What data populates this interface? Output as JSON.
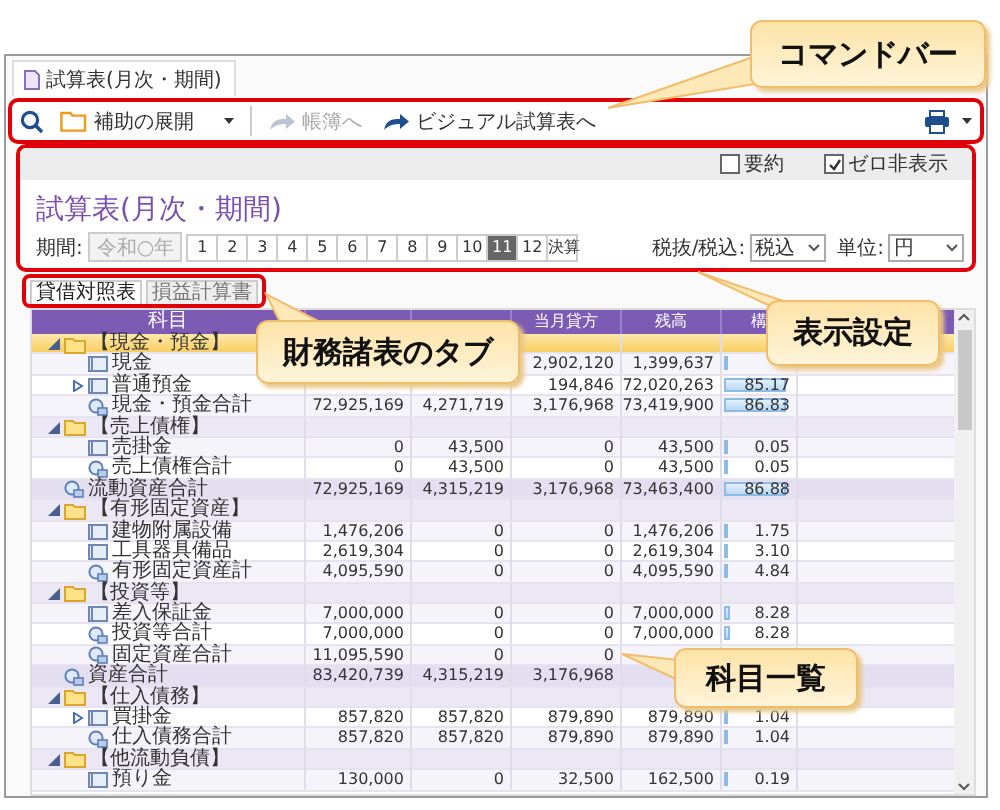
{
  "document_tab": {
    "title": "試算表(月次・期間)"
  },
  "command_bar": {
    "buttons": [
      {
        "kind": "expand",
        "label": "補助の展開",
        "disabled": false
      },
      {
        "kind": "jump",
        "label": "帳簿へ",
        "disabled": true
      },
      {
        "kind": "jump",
        "label": "ビジュアル試算表へ",
        "disabled": false
      }
    ]
  },
  "options": [
    {
      "label": "要約",
      "checked": false
    },
    {
      "label": "ゼロ非表示",
      "checked": true
    }
  ],
  "title": "試算表(月次・期間)",
  "period": {
    "label": "期間:",
    "year": "令和○年",
    "year_disabled": true,
    "months": [
      {
        "label": "1",
        "selected": false
      },
      {
        "label": "2",
        "selected": false
      },
      {
        "label": "3",
        "selected": false
      },
      {
        "label": "4",
        "selected": false
      },
      {
        "label": "5",
        "selected": false
      },
      {
        "label": "6",
        "selected": false
      },
      {
        "label": "7",
        "selected": false
      },
      {
        "label": "8",
        "selected": false
      },
      {
        "label": "9",
        "selected": false
      },
      {
        "label": "10",
        "selected": false
      },
      {
        "label": "11",
        "selected": true
      },
      {
        "label": "12",
        "selected": false
      },
      {
        "label": "決算",
        "selected": false
      }
    ]
  },
  "tax": {
    "label": "税抜/税込:",
    "value": "税込"
  },
  "unit": {
    "label": "単位:",
    "value": "円"
  },
  "statement_tabs": [
    {
      "label": "貸借対照表",
      "selected": true
    },
    {
      "label": "損益計算書",
      "selected": false
    }
  ],
  "table": {
    "columns": {
      "column_1": "科目",
      "column_4": "当月貸方",
      "column_5": "残高",
      "column_6": "構"
    },
    "rows": [
      {
        "kind": "group",
        "name": "【現金・預金】",
        "expanded": true,
        "selected": true,
        "children": [
          {
            "kind": "account",
            "name": "現金",
            "values": {
              "column_4": "2,902,120",
              "column_5": "1,399,637"
            },
            "level": 0.0165
          },
          {
            "kind": "account",
            "name": "普通預金",
            "expanded": false,
            "values": {
              "column_4": "194,846",
              "column_5": "72,020,263",
              "column_6": "85.17"
            },
            "level": 0.8517
          },
          {
            "kind": "total",
            "name": "現金・預金合計",
            "values": {
              "column_2": "72,925,169",
              "column_3": "4,271,719",
              "column_4": "3,176,968",
              "column_5": "73,419,900",
              "column_6": "86.83"
            },
            "level": 0.8683
          }
        ]
      },
      {
        "kind": "group",
        "name": "【売上債権】",
        "expanded": true,
        "selected": false,
        "children": [
          {
            "kind": "account",
            "name": "売掛金",
            "values": {
              "column_2": "0",
              "column_3": "43,500",
              "column_4": "0",
              "column_5": "43,500",
              "column_6": "0.05"
            },
            "level": 0.0005
          },
          {
            "kind": "total",
            "name": "売上債権合計",
            "values": {
              "column_2": "0",
              "column_3": "43,500",
              "column_4": "0",
              "column_5": "43,500",
              "column_6": "0.05"
            },
            "level": 0.0005
          }
        ]
      },
      {
        "kind": "total",
        "name": "流動資産合計",
        "values": {
          "column_2": "72,925,169",
          "column_3": "4,315,219",
          "column_4": "3,176,968",
          "column_5": "73,463,400",
          "column_6": "86.88"
        },
        "level": 0.8688
      },
      {
        "kind": "group",
        "name": "【有形固定資産】",
        "expanded": true,
        "selected": false,
        "children": [
          {
            "kind": "account",
            "name": "建物附属設備",
            "values": {
              "column_2": "1,476,206",
              "column_3": "0",
              "column_4": "0",
              "column_5": "1,476,206",
              "column_6": "1.75"
            },
            "level": 0.0175
          },
          {
            "kind": "account",
            "name": "工具器具備品",
            "values": {
              "column_2": "2,619,304",
              "column_3": "0",
              "column_4": "0",
              "column_5": "2,619,304",
              "column_6": "3.10"
            },
            "level": 0.031
          },
          {
            "kind": "total",
            "name": "有形固定資産計",
            "values": {
              "column_2": "4,095,590",
              "column_3": "0",
              "column_4": "0",
              "column_5": "4,095,590",
              "column_6": "4.84"
            },
            "level": 0.0484
          }
        ]
      },
      {
        "kind": "group",
        "name": "【投資等】",
        "expanded": true,
        "selected": false,
        "children": [
          {
            "kind": "account",
            "name": "差入保証金",
            "values": {
              "column_2": "7,000,000",
              "column_3": "0",
              "column_4": "0",
              "column_5": "7,000,000",
              "column_6": "8.28"
            },
            "level": 0.0828
          },
          {
            "kind": "total",
            "name": "投資等合計",
            "values": {
              "column_2": "7,000,000",
              "column_3": "0",
              "column_4": "0",
              "column_5": "7,000,000",
              "column_6": "8.28"
            },
            "level": 0.0828
          },
          {
            "kind": "total",
            "name": "固定資産合計",
            "values": {
              "column_2": "11,095,590",
              "column_3": "0",
              "column_4": "0"
            }
          }
        ]
      },
      {
        "kind": "total",
        "name": "資産合計",
        "values": {
          "column_2": "83,420,739",
          "column_3": "4,315,219",
          "column_4": "3,176,968"
        }
      },
      {
        "kind": "group",
        "name": "【仕入債務】",
        "expanded": true,
        "selected": false,
        "children": [
          {
            "kind": "account",
            "name": "買掛金",
            "expanded": false,
            "values": {
              "column_2": "857,820",
              "column_3": "857,820",
              "column_4": "879,890",
              "column_5": "879,890",
              "column_6": "1.04"
            },
            "level": 0.0104
          },
          {
            "kind": "total",
            "name": "仕入債務合計",
            "values": {
              "column_2": "857,820",
              "column_3": "857,820",
              "column_4": "879,890",
              "column_5": "879,890",
              "column_6": "1.04"
            },
            "level": 0.0104
          }
        ]
      },
      {
        "kind": "group",
        "name": "【他流動負債】",
        "expanded": true,
        "selected": false,
        "children": [
          {
            "kind": "account",
            "name": "預り金",
            "values": {
              "column_2": "130,000",
              "column_3": "0",
              "column_4": "32,500",
              "column_5": "162,500",
              "column_6": "0.19"
            },
            "level": 0.0019
          }
        ]
      }
    ]
  },
  "callouts": [
    {
      "text": "コマンドバー"
    },
    {
      "text": "表示設定"
    },
    {
      "text": "財務諸表のタブ"
    },
    {
      "text": "科目一覧"
    }
  ]
}
